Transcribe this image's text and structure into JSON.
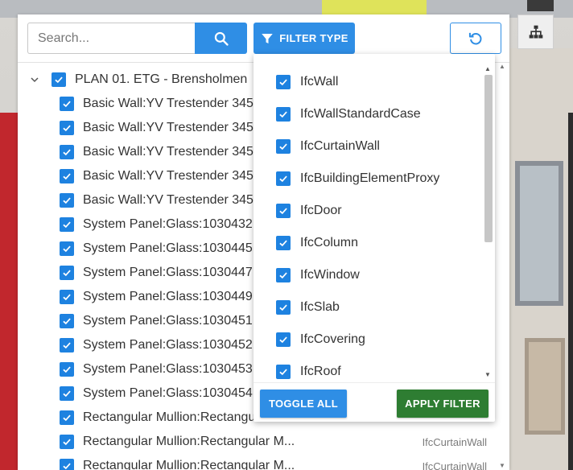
{
  "colors": {
    "primary": "#2f8ee5",
    "checkbox": "#1e82e0",
    "apply": "#2e7d32"
  },
  "search": {
    "placeholder": "Search...",
    "value": "",
    "button_icon": "search-icon"
  },
  "toolbar": {
    "filter_type_label": "FILTER TYPE",
    "filter_icon": "filter-icon",
    "reset_icon": "reset-icon",
    "hierarchy_icon": "hierarchy-icon"
  },
  "tree": {
    "root": {
      "label": "PLAN 01. ETG - Brensholmen",
      "checked": true,
      "expanded": true
    },
    "items": [
      {
        "label": "Basic Wall:YV Trestender 345",
        "type": "",
        "checked": true
      },
      {
        "label": "Basic Wall:YV Trestender 345",
        "type": "",
        "checked": true
      },
      {
        "label": "Basic Wall:YV Trestender 345",
        "type": "",
        "checked": true
      },
      {
        "label": "Basic Wall:YV Trestender 345",
        "type": "",
        "checked": true
      },
      {
        "label": "Basic Wall:YV Trestender 345",
        "type": "",
        "checked": true
      },
      {
        "label": "System Panel:Glass:1030432",
        "type": "",
        "checked": true
      },
      {
        "label": "System Panel:Glass:1030445",
        "type": "",
        "checked": true
      },
      {
        "label": "System Panel:Glass:1030447",
        "type": "",
        "checked": true
      },
      {
        "label": "System Panel:Glass:1030449",
        "type": "",
        "checked": true
      },
      {
        "label": "System Panel:Glass:1030451",
        "type": "",
        "checked": true
      },
      {
        "label": "System Panel:Glass:1030452",
        "type": "",
        "checked": true
      },
      {
        "label": "System Panel:Glass:1030453",
        "type": "",
        "checked": true
      },
      {
        "label": "System Panel:Glass:1030454",
        "type": "",
        "checked": true
      },
      {
        "label": "Rectangular Mullion:Rectangular M...",
        "type": "",
        "checked": true
      },
      {
        "label": "Rectangular Mullion:Rectangular M...",
        "type": "IfcCurtainWall",
        "checked": true
      },
      {
        "label": "Rectangular Mullion:Rectangular M...",
        "type": "IfcCurtainWall",
        "checked": true
      }
    ]
  },
  "filter_dropdown": {
    "items": [
      {
        "label": "IfcWall",
        "checked": true
      },
      {
        "label": "IfcWallStandardCase",
        "checked": true
      },
      {
        "label": "IfcCurtainWall",
        "checked": true
      },
      {
        "label": "IfcBuildingElementProxy",
        "checked": true
      },
      {
        "label": "IfcDoor",
        "checked": true
      },
      {
        "label": "IfcColumn",
        "checked": true
      },
      {
        "label": "IfcWindow",
        "checked": true
      },
      {
        "label": "IfcSlab",
        "checked": true
      },
      {
        "label": "IfcCovering",
        "checked": true
      },
      {
        "label": "IfcRoof",
        "checked": true
      }
    ],
    "toggle_all_label": "TOGGLE ALL",
    "apply_filter_label": "APPLY FILTER"
  }
}
